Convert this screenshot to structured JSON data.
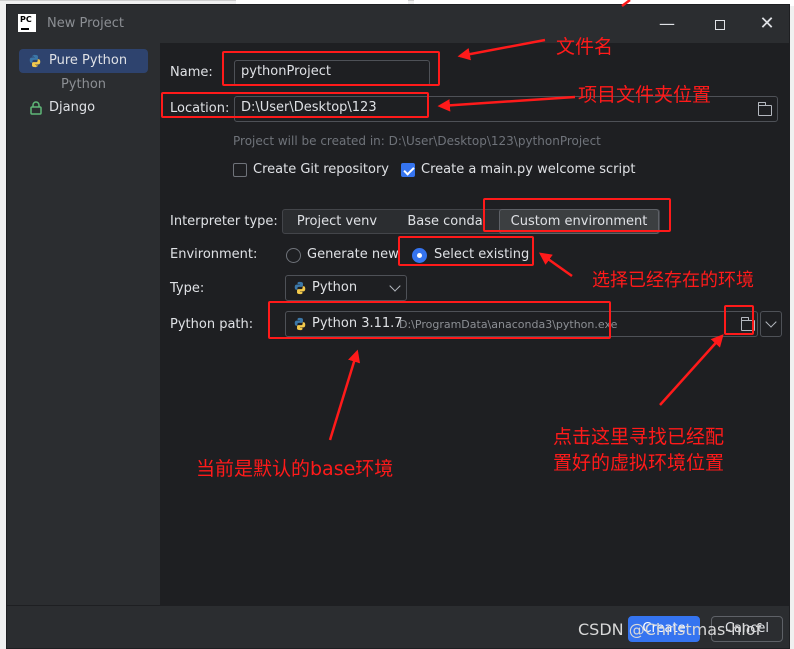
{
  "window": {
    "title": "New Project"
  },
  "sidebar": {
    "items": [
      {
        "label": "Pure Python"
      },
      {
        "label": "Django"
      }
    ],
    "group": "Python"
  },
  "form": {
    "name_label": "Name:",
    "name_value": "pythonProject",
    "location_label": "Location:",
    "location_value": "D:\\User\\Desktop\\123",
    "location_hint": "Project will be created in: D:\\User\\Desktop\\123\\pythonProject",
    "git_label": "Create Git repository",
    "git_checked": false,
    "main_label": "Create a main.py welcome script",
    "main_checked": true,
    "interpreter_label": "Interpreter type:",
    "interpreter_options": [
      "Project venv",
      "Base conda",
      "Custom environment"
    ],
    "interpreter_selected": "Custom environment",
    "environment_label": "Environment:",
    "env_generate": "Generate new",
    "env_existing": "Select existing",
    "env_selected": "Select existing",
    "type_label": "Type:",
    "type_value": "Python",
    "path_label": "Python path:",
    "path_name": "Python 3.11.7",
    "path_value": "D:\\ProgramData\\anaconda3\\python.exe"
  },
  "footer": {
    "create": "Create",
    "cancel": "Cancel"
  },
  "annotations": {
    "name": "文件名",
    "location": "项目文件夹位置",
    "select_existing": "选择已经存在的环境",
    "default_base": "当前是默认的base环境",
    "browse_line1": "点击这里寻找已经配",
    "browse_line2": "置好的虚拟环境位置"
  },
  "watermark": "CSDN @Christmas-hlof",
  "colors": {
    "accent": "#3574f0",
    "annotation": "#ff1a1a",
    "panel": "#2b2d30",
    "content": "#1e1f22"
  }
}
